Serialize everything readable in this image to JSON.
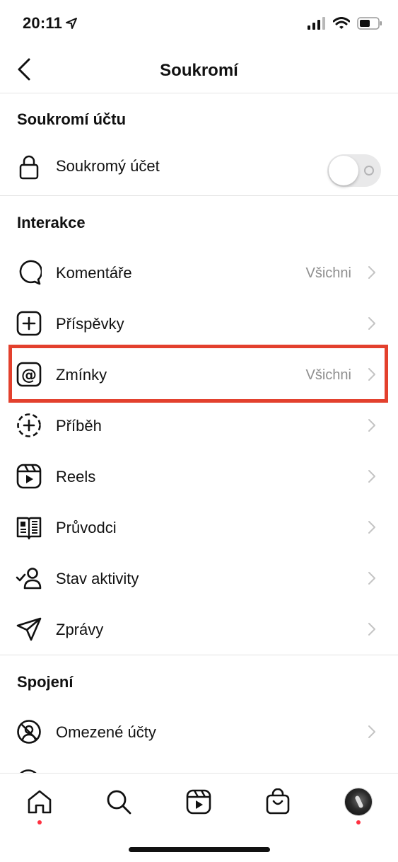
{
  "status_bar": {
    "time": "20:11"
  },
  "nav": {
    "title": "Soukromí"
  },
  "sections": {
    "account": {
      "title": "Soukromí účtu",
      "private_account_label": "Soukromý účet",
      "private_account_enabled": false
    },
    "interactions": {
      "title": "Interakce",
      "items": [
        {
          "label": "Komentáře",
          "value": "Všichni",
          "icon": "comment-icon"
        },
        {
          "label": "Příspěvky",
          "value": "",
          "icon": "add-post-icon"
        },
        {
          "label": "Zmínky",
          "value": "Všichni",
          "icon": "at-sign-icon"
        },
        {
          "label": "Příběh",
          "value": "",
          "icon": "add-story-icon"
        },
        {
          "label": "Reels",
          "value": "",
          "icon": "reels-icon"
        },
        {
          "label": "Průvodci",
          "value": "",
          "icon": "guides-icon"
        },
        {
          "label": "Stav aktivity",
          "value": "",
          "icon": "activity-status-icon"
        },
        {
          "label": "Zprávy",
          "value": "",
          "icon": "paper-plane-icon"
        }
      ]
    },
    "connections": {
      "title": "Spojení",
      "items": [
        {
          "label": "Omezené účty",
          "value": "",
          "icon": "restricted-accounts-icon"
        }
      ]
    }
  },
  "highlight_color": "#e3402d",
  "tab_bar": {
    "tabs": [
      "home-icon",
      "search-icon",
      "reels-icon",
      "shop-icon",
      "profile-avatar"
    ],
    "notification_dot_color": "#ff3040"
  }
}
